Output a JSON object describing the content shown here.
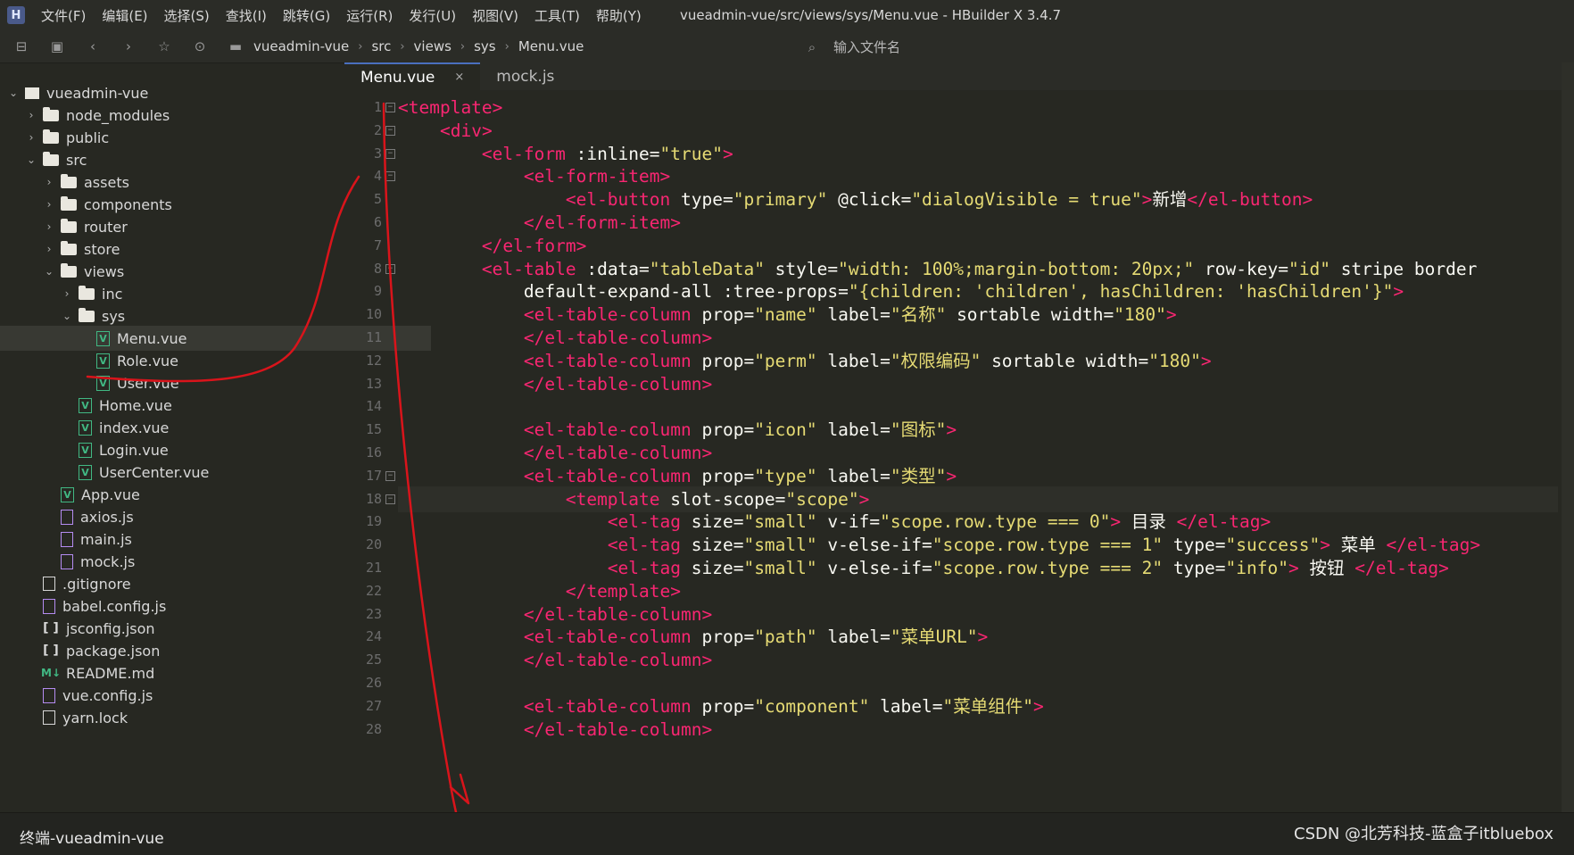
{
  "app": {
    "logo_text": "H"
  },
  "menu": [
    "文件(F)",
    "编辑(E)",
    "选择(S)",
    "查找(I)",
    "跳转(G)",
    "运行(R)",
    "发行(U)",
    "视图(V)",
    "工具(T)",
    "帮助(Y)"
  ],
  "window_title": "vueadmin-vue/src/views/sys/Menu.vue - HBuilder X 3.4.7",
  "breadcrumb": [
    "vueadmin-vue",
    "src",
    "views",
    "sys",
    "Menu.vue"
  ],
  "file_search_placeholder": "输入文件名",
  "tree": [
    {
      "label": "vueadmin-vue",
      "icon": "project-icon",
      "expanded": true
    },
    {
      "label": "node_modules",
      "icon": "folder-icon",
      "expanded": false
    },
    {
      "label": "public",
      "icon": "folder-icon",
      "expanded": false
    },
    {
      "label": "src",
      "icon": "folder-open-icon",
      "expanded": true
    },
    {
      "label": "assets",
      "icon": "folder-icon",
      "expanded": false
    },
    {
      "label": "components",
      "icon": "folder-icon",
      "expanded": false
    },
    {
      "label": "router",
      "icon": "folder-icon",
      "expanded": false
    },
    {
      "label": "store",
      "icon": "folder-icon",
      "expanded": false
    },
    {
      "label": "views",
      "icon": "folder-open-icon",
      "expanded": true
    },
    {
      "label": "inc",
      "icon": "folder-icon",
      "expanded": false
    },
    {
      "label": "sys",
      "icon": "folder-open-icon",
      "expanded": true
    },
    {
      "label": "Menu.vue",
      "icon": "vue-file-icon",
      "selected": true
    },
    {
      "label": "Role.vue",
      "icon": "vue-file-icon"
    },
    {
      "label": "User.vue",
      "icon": "vue-file-icon"
    },
    {
      "label": "Home.vue",
      "icon": "vue-file-icon"
    },
    {
      "label": "index.vue",
      "icon": "vue-file-icon"
    },
    {
      "label": "Login.vue",
      "icon": "vue-file-icon"
    },
    {
      "label": "UserCenter.vue",
      "icon": "vue-file-icon"
    },
    {
      "label": "App.vue",
      "icon": "vue-file-icon"
    },
    {
      "label": "axios.js",
      "icon": "js-file-icon"
    },
    {
      "label": "main.js",
      "icon": "js-file-icon"
    },
    {
      "label": "mock.js",
      "icon": "js-file-icon"
    },
    {
      "label": ".gitignore",
      "icon": "file-icon"
    },
    {
      "label": "babel.config.js",
      "icon": "js-file-icon"
    },
    {
      "label": "jsconfig.json",
      "icon": "json-file-icon"
    },
    {
      "label": "package.json",
      "icon": "json-file-icon"
    },
    {
      "label": "README.md",
      "icon": "markdown-file-icon"
    },
    {
      "label": "vue.config.js",
      "icon": "js-file-icon"
    },
    {
      "label": "yarn.lock",
      "icon": "file-icon"
    }
  ],
  "tabs": [
    {
      "label": "Menu.vue",
      "active": true,
      "close": "×"
    },
    {
      "label": "mock.js",
      "active": false
    }
  ],
  "code_lines": [
    {
      "n": "1",
      "fold": true,
      "text": "<template>"
    },
    {
      "n": "2",
      "fold": true,
      "text": "    <div>"
    },
    {
      "n": "3",
      "fold": true,
      "text": "        <el-form :inline=\"true\">"
    },
    {
      "n": "4",
      "fold": true,
      "text": "            <el-form-item>"
    },
    {
      "n": "5",
      "fold": false,
      "text": "                <el-button type=\"primary\" @click=\"dialogVisible = true\">新增</el-button>"
    },
    {
      "n": "6",
      "fold": false,
      "text": "            </el-form-item>"
    },
    {
      "n": "7",
      "fold": false,
      "text": "        </el-form>"
    },
    {
      "n": "8",
      "fold": true,
      "text": "        <el-table :data=\"tableData\" style=\"width: 100%;margin-bottom: 20px;\" row-key=\"id\" stripe border"
    },
    {
      "n": "9",
      "fold": false,
      "text": "            default-expand-all :tree-props=\"{children: 'children', hasChildren: 'hasChildren'}\">"
    },
    {
      "n": "10",
      "fold": false,
      "text": "            <el-table-column prop=\"name\" label=\"名称\" sortable width=\"180\">"
    },
    {
      "n": "11",
      "fold": false,
      "text": "            </el-table-column>"
    },
    {
      "n": "12",
      "fold": false,
      "text": "            <el-table-column prop=\"perm\" label=\"权限编码\" sortable width=\"180\">"
    },
    {
      "n": "13",
      "fold": false,
      "text": "            </el-table-column>"
    },
    {
      "n": "14",
      "fold": false,
      "text": ""
    },
    {
      "n": "15",
      "fold": false,
      "text": "            <el-table-column prop=\"icon\" label=\"图标\">"
    },
    {
      "n": "16",
      "fold": false,
      "text": "            </el-table-column>"
    },
    {
      "n": "17",
      "fold": true,
      "text": "            <el-table-column prop=\"type\" label=\"类型\">"
    },
    {
      "n": "18",
      "fold": true,
      "cur": true,
      "text": "                <template slot-scope=\"scope\">"
    },
    {
      "n": "19",
      "fold": false,
      "text": "                    <el-tag size=\"small\" v-if=\"scope.row.type === 0\"> 目录 </el-tag>"
    },
    {
      "n": "20",
      "fold": false,
      "text": "                    <el-tag size=\"small\" v-else-if=\"scope.row.type === 1\" type=\"success\"> 菜单 </el-tag>"
    },
    {
      "n": "21",
      "fold": false,
      "text": "                    <el-tag size=\"small\" v-else-if=\"scope.row.type === 2\" type=\"info\"> 按钮 </el-tag>"
    },
    {
      "n": "22",
      "fold": false,
      "text": "                </template>"
    },
    {
      "n": "23",
      "fold": false,
      "text": "            </el-table-column>"
    },
    {
      "n": "24",
      "fold": false,
      "text": "            <el-table-column prop=\"path\" label=\"菜单URL\">"
    },
    {
      "n": "25",
      "fold": false,
      "text": "            </el-table-column>"
    },
    {
      "n": "26",
      "fold": false,
      "text": ""
    },
    {
      "n": "27",
      "fold": false,
      "text": "            <el-table-column prop=\"component\" label=\"菜单组件\">"
    },
    {
      "n": "28",
      "fold": false,
      "text": "            </el-table-column>"
    }
  ],
  "status": {
    "terminal": "终端-vueadmin-vue"
  },
  "watermark": "CSDN @北芳科技-蓝盒子itbluebox",
  "colors": {
    "background": "#272822",
    "tag": "#f92672",
    "attribute": "#a6e22e",
    "string": "#e6db74",
    "annotation": "#d9141b"
  }
}
